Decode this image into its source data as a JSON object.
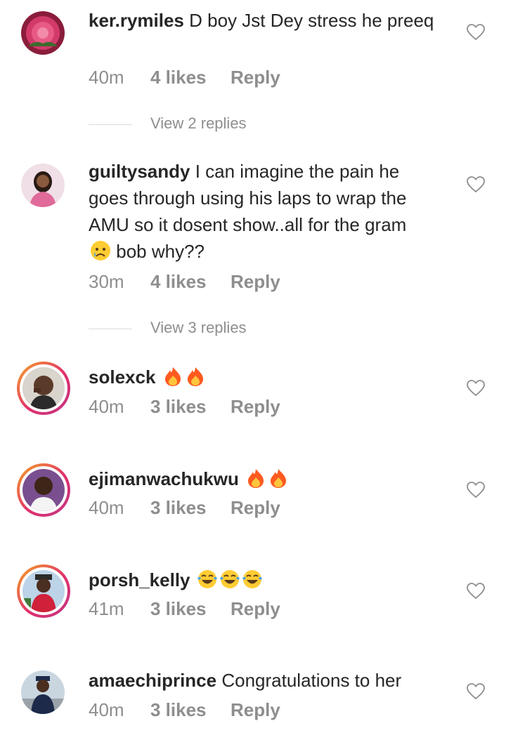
{
  "comments": [
    {
      "username": "ker.rymiles",
      "text": "D boy Jst Dey stress he preeq",
      "time": "40m",
      "likes": "4 likes",
      "reply": "Reply",
      "view_replies": "View 2 replies"
    },
    {
      "username": "guiltysandy",
      "text": "I can imagine the pain he goes through using his laps to wrap the AMU so it dosent show..all for the gram",
      "text2": "bob why??",
      "time": "30m",
      "likes": "4 likes",
      "reply": "Reply",
      "view_replies": "View 3 replies"
    },
    {
      "username": "solexck",
      "emojis": [
        "fire-icon",
        "fire-icon"
      ],
      "time": "40m",
      "likes": "3 likes",
      "reply": "Reply"
    },
    {
      "username": "ejimanwachukwu",
      "emojis": [
        "fire-icon",
        "fire-icon"
      ],
      "time": "40m",
      "likes": "3 likes",
      "reply": "Reply"
    },
    {
      "username": "porsh_kelly",
      "emojis": [
        "tears-of-joy-icon",
        "tears-of-joy-icon",
        "tears-of-joy-icon"
      ],
      "time": "41m",
      "likes": "3 likes",
      "reply": "Reply"
    },
    {
      "username": "amaechiprince",
      "text": "Congratulations to her",
      "time": "40m",
      "likes": "3 likes",
      "reply": "Reply"
    }
  ],
  "colors": {
    "text": "#262626",
    "meta": "#8e8e8e",
    "story_ring_start": "#f5a623",
    "story_ring_end": "#c13584"
  }
}
